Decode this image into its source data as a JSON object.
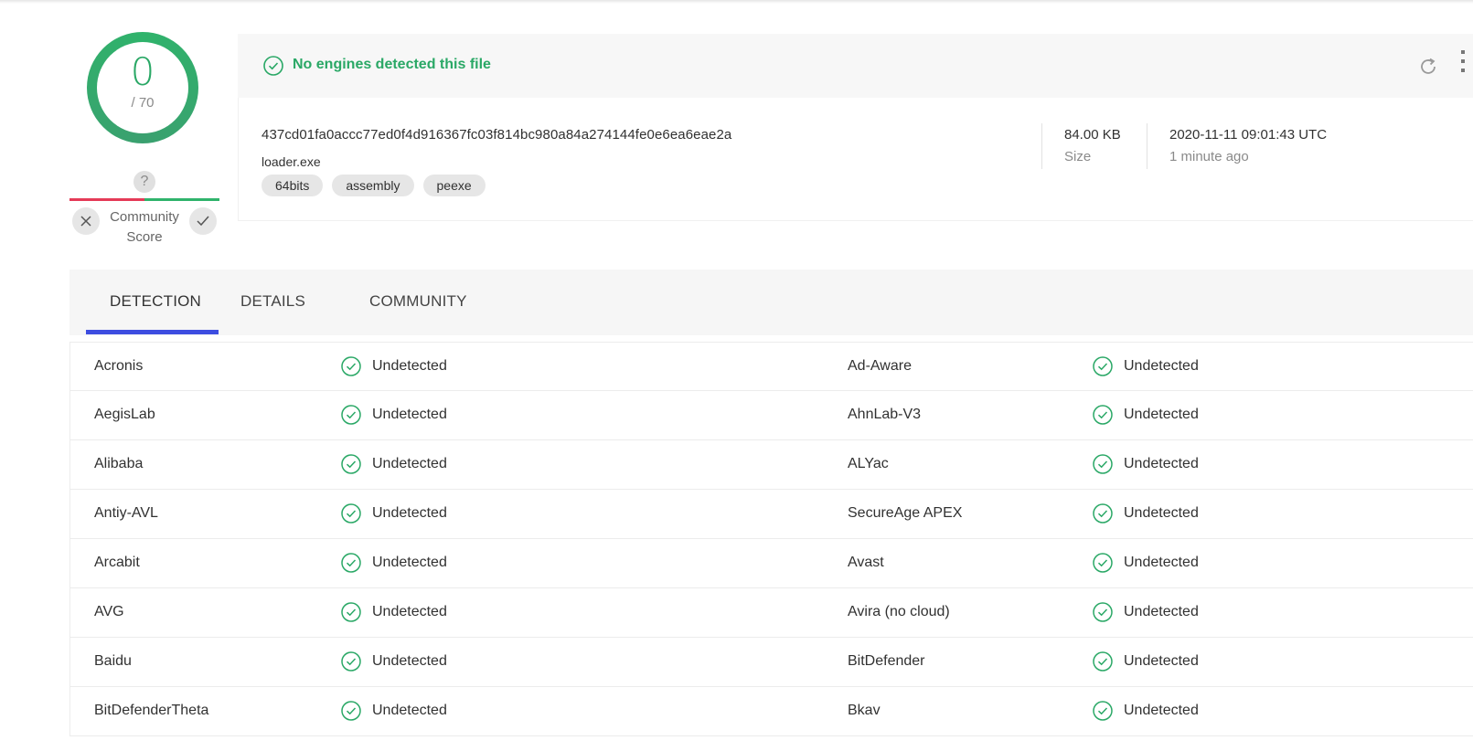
{
  "score": {
    "value": "0",
    "total": "/ 70"
  },
  "community": {
    "question": "?",
    "label_line1": "Community",
    "label_line2": "Score",
    "down_icon": "close-icon",
    "up_icon": "check-icon"
  },
  "colors": {
    "green": "#2aa866",
    "red": "#e53a57",
    "accent": "#3d4de0"
  },
  "status": {
    "text": "No engines detected this file"
  },
  "file": {
    "hash": "437cd01fa0accc77ed0f4d916367fc03f814bc980a84a274144fe0e6ea6eae2a",
    "name": "loader.exe",
    "tags": [
      "64bits",
      "assembly",
      "peexe"
    ],
    "size": "84.00 KB",
    "size_label": "Size",
    "date": "2020-11-11 09:01:43 UTC",
    "date_relative": "1 minute ago"
  },
  "tabs": [
    {
      "label": "DETECTION",
      "active": true
    },
    {
      "label": "DETAILS",
      "active": false
    },
    {
      "label": "COMMUNITY",
      "active": false
    }
  ],
  "detections": [
    {
      "left": {
        "engine": "Acronis",
        "result": "Undetected"
      },
      "right": {
        "engine": "Ad-Aware",
        "result": "Undetected"
      }
    },
    {
      "left": {
        "engine": "AegisLab",
        "result": "Undetected"
      },
      "right": {
        "engine": "AhnLab-V3",
        "result": "Undetected"
      }
    },
    {
      "left": {
        "engine": "Alibaba",
        "result": "Undetected"
      },
      "right": {
        "engine": "ALYac",
        "result": "Undetected"
      }
    },
    {
      "left": {
        "engine": "Antiy-AVL",
        "result": "Undetected"
      },
      "right": {
        "engine": "SecureAge APEX",
        "result": "Undetected"
      }
    },
    {
      "left": {
        "engine": "Arcabit",
        "result": "Undetected"
      },
      "right": {
        "engine": "Avast",
        "result": "Undetected"
      }
    },
    {
      "left": {
        "engine": "AVG",
        "result": "Undetected"
      },
      "right": {
        "engine": "Avira (no cloud)",
        "result": "Undetected"
      }
    },
    {
      "left": {
        "engine": "Baidu",
        "result": "Undetected"
      },
      "right": {
        "engine": "BitDefender",
        "result": "Undetected"
      }
    },
    {
      "left": {
        "engine": "BitDefenderTheta",
        "result": "Undetected"
      },
      "right": {
        "engine": "Bkav",
        "result": "Undetected"
      }
    }
  ]
}
